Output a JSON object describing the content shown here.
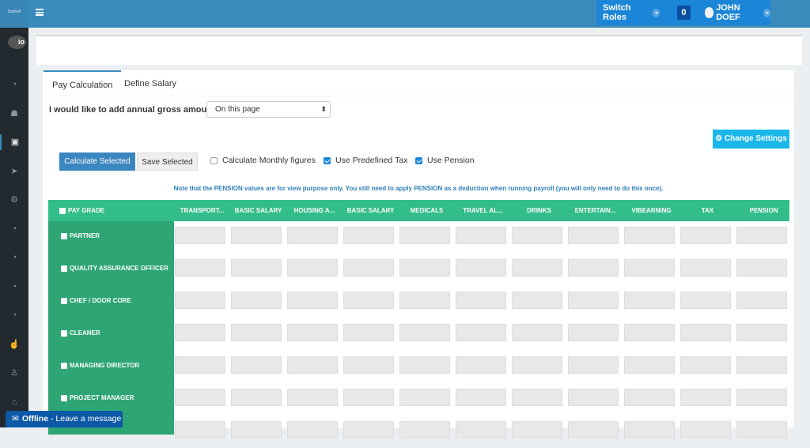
{
  "header": {
    "brand": "Dashell",
    "switch_roles": "Switch Roles",
    "notif_count": "0",
    "user": "JOHN DOEF"
  },
  "sidebar": {
    "logo": "io",
    "items": [
      "dashboard",
      "users",
      "money",
      "send",
      "cogs",
      "dashboard",
      "dashboard",
      "dashboard",
      "dashboard",
      "thumbs-up",
      "person",
      "home"
    ],
    "active": 2
  },
  "tabs": [
    {
      "label": "Pay Calculation",
      "active": true
    },
    {
      "label": "Define Salary",
      "active": false
    }
  ],
  "form": {
    "gross_label": "I would like to add annual gross amount:",
    "gross_select": "On this page",
    "change_settings": "⚙ Change Settings",
    "calculate_selected": "Calculate Selected",
    "save_selected": "Save Selected",
    "options": [
      {
        "label": "Calculate Monthly figures",
        "checked": false
      },
      {
        "label": "Use Predefined Tax",
        "checked": true
      },
      {
        "label": "Use Pension",
        "checked": true
      }
    ]
  },
  "note": "Note that the PENSION values are for view purpose only. You still need to apply PENSION as a deduction when running payroll (you will only need to do this once).",
  "table": {
    "first_header": "PAY GRADE",
    "columns": [
      "TRANSPORT...",
      "BASIC SALARY",
      "HOUSING A...",
      "BASIC SALARY",
      "MEDICALS",
      "TRAVEL AL...",
      "DRINKS",
      "ENTERTAIN...",
      "VIBEARNING",
      "TAX",
      "PENSION"
    ],
    "rows": [
      "PARTNER",
      "QUALITY ASSURANCE OFFICER",
      "CHEF / DOOR CORE",
      "CLEANER",
      "MANAGING DIRECTOR",
      "PROJECT MANAGER",
      ""
    ]
  },
  "chat": {
    "status": "Offline",
    "message": "- Leave a message"
  },
  "colors": {
    "header": "#3a8bbb",
    "table_header": "#33bd8a",
    "grade_col": "#2ea574",
    "primary": "#3a86c1",
    "info": "#1ab7ea"
  }
}
